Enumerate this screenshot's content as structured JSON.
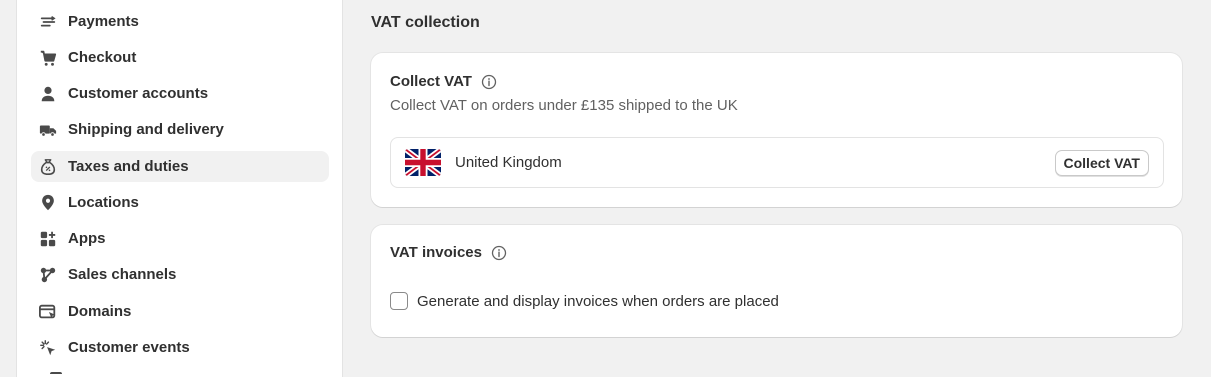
{
  "sidebar": {
    "items": [
      {
        "label": "Payments",
        "icon": "payments-icon"
      },
      {
        "label": "Checkout",
        "icon": "cart-icon"
      },
      {
        "label": "Customer accounts",
        "icon": "person-icon"
      },
      {
        "label": "Shipping and delivery",
        "icon": "truck-icon"
      },
      {
        "label": "Taxes and duties",
        "icon": "tax-bag-icon",
        "active": true
      },
      {
        "label": "Locations",
        "icon": "location-pin-icon"
      },
      {
        "label": "Apps",
        "icon": "apps-icon"
      },
      {
        "label": "Sales channels",
        "icon": "sales-channels-icon"
      },
      {
        "label": "Domains",
        "icon": "domains-icon"
      },
      {
        "label": "Customer events",
        "icon": "cursor-click-icon"
      }
    ]
  },
  "main": {
    "section_title": "VAT collection",
    "collect_vat": {
      "heading": "Collect VAT",
      "description": "Collect VAT on orders under £135 shipped to the UK",
      "country": "United Kingdom",
      "button_label": "Collect VAT"
    },
    "vat_invoices": {
      "heading": "VAT invoices",
      "checkbox_label": "Generate and display invoices when orders are placed",
      "checked": false
    }
  },
  "colors": {
    "background": "#f1f1f1",
    "card": "#ffffff",
    "text": "#303030",
    "muted_text": "#616161",
    "active_nav": "#f1f1f1"
  }
}
